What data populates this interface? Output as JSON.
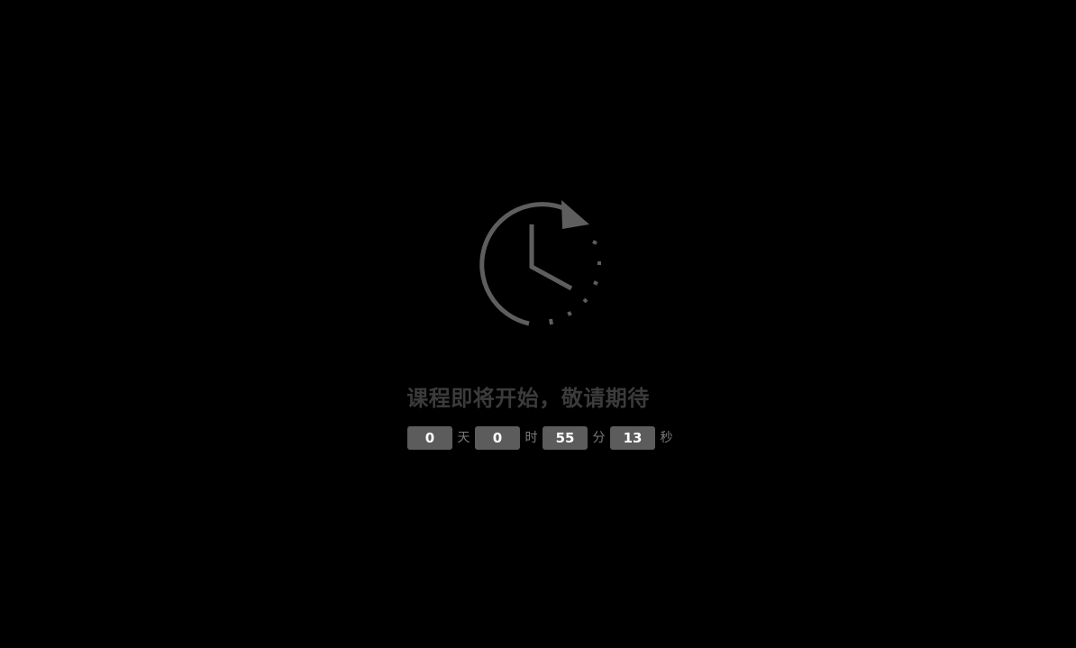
{
  "icon": "clock-countdown-icon",
  "colors": {
    "background": "#000000",
    "icon": "#5e5e5e",
    "headline": "#3b3b3b",
    "number_box": "#5c5c5c",
    "number_text": "#ffffff",
    "unit_text": "#7a7a7a"
  },
  "message": "课程即将开始，敬请期待",
  "countdown": {
    "days": "0",
    "days_unit": "天",
    "hours": "0",
    "hours_unit": "时",
    "minutes": "55",
    "minutes_unit": "分",
    "seconds": "13",
    "seconds_unit": "秒"
  }
}
